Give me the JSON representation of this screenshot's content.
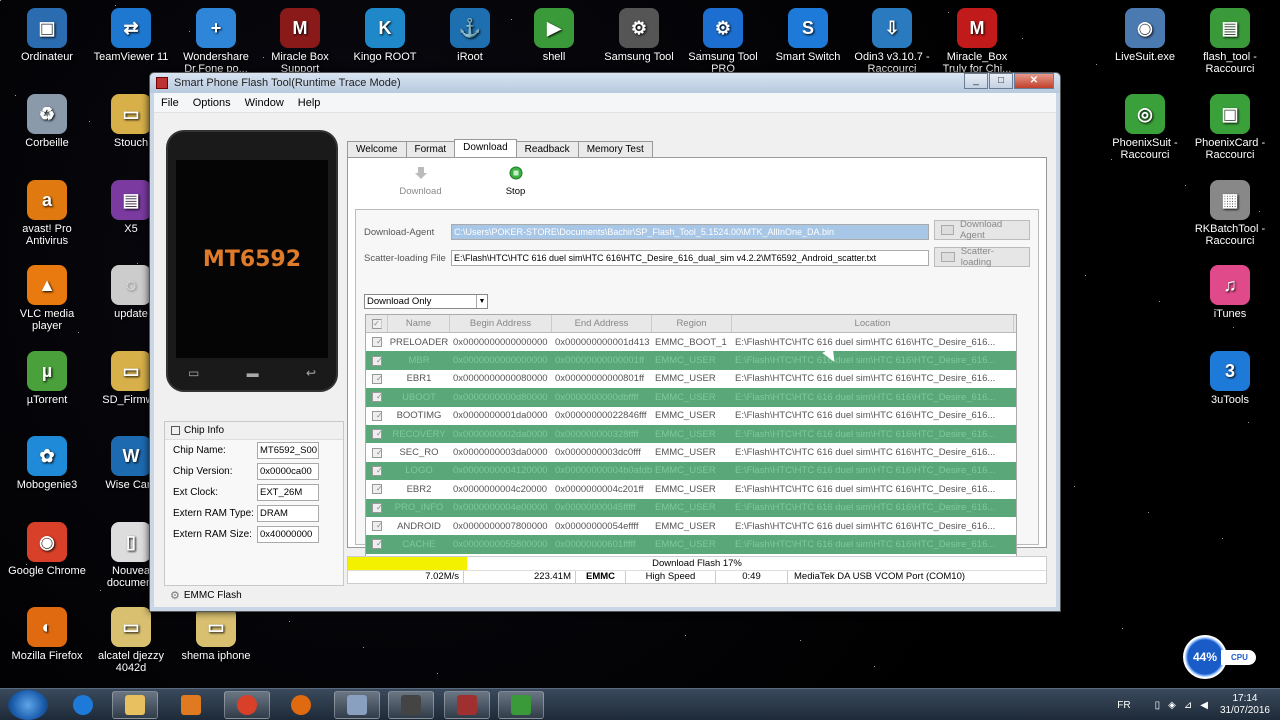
{
  "desktop_icons": [
    {
      "name": "ordinateur",
      "label": "Ordinateur",
      "color": "#2b6cb0",
      "glyph": "▣"
    },
    {
      "name": "teamviewer",
      "label": "TeamViewer 11",
      "color": "#1e78d0",
      "glyph": "⇄"
    },
    {
      "name": "wondershare",
      "label": "Wondershare Dr.Fone po...",
      "color": "#2f85d8",
      "glyph": "+"
    },
    {
      "name": "miracle-box",
      "label": "Miracle Box Support",
      "color": "#8a1a1a",
      "glyph": "M"
    },
    {
      "name": "kingo-root",
      "label": "Kingo ROOT",
      "color": "#1e88c8",
      "glyph": "K"
    },
    {
      "name": "iroot",
      "label": "iRoot",
      "color": "#1e6fb0",
      "glyph": "⚓"
    },
    {
      "name": "shell",
      "label": "shell",
      "color": "#3a9a3a",
      "glyph": "▶"
    },
    {
      "name": "samsung-tool",
      "label": "Samsung Tool",
      "color": "#555",
      "glyph": "⚙"
    },
    {
      "name": "samsung-tool-pro",
      "label": "Samsung Tool PRO",
      "color": "#1c6fd0",
      "glyph": "⚙"
    },
    {
      "name": "smart-switch",
      "label": "Smart Switch",
      "color": "#1e7ad8",
      "glyph": "S"
    },
    {
      "name": "odin",
      "label": "Odin3 v3.10.7 - Raccourci",
      "color": "#2a7ac0",
      "glyph": "⇩"
    },
    {
      "name": "miracle-box-truly",
      "label": "Miracle_Box Truly for Chi...",
      "color": "#c01a1a",
      "glyph": "M"
    },
    {
      "name": "livesuit",
      "label": "LiveSuit.exe",
      "color": "#4a7ab0",
      "glyph": "◉"
    },
    {
      "name": "flash-tool",
      "label": "flash_tool - Raccourci",
      "color": "#3a9a3a",
      "glyph": "▤"
    },
    {
      "name": "corbeille",
      "label": "Corbeille",
      "color": "#8a9aaa",
      "glyph": "♻"
    },
    {
      "name": "stouch",
      "label": "Stouch",
      "color": "#d8b04a",
      "glyph": "▭"
    },
    {
      "name": "phoenixsuit",
      "label": "PhoenixSuit - Raccourci",
      "color": "#3aa03a",
      "glyph": "◎"
    },
    {
      "name": "phoenixcard",
      "label": "PhoenixCard - Raccourci",
      "color": "#3aa03a",
      "glyph": "▣"
    },
    {
      "name": "avast",
      "label": "avast! Pro Antivirus",
      "color": "#e07a10",
      "glyph": "a"
    },
    {
      "name": "x5",
      "label": "X5",
      "color": "#7a3aa0",
      "glyph": "▤"
    },
    {
      "name": "rkbatchtool",
      "label": "RKBatchTool - Raccourci",
      "color": "#888",
      "glyph": "▦"
    },
    {
      "name": "vlc",
      "label": "VLC media player",
      "color": "#e87a10",
      "glyph": "▲"
    },
    {
      "name": "update",
      "label": "update",
      "color": "#ccc",
      "glyph": "◌"
    },
    {
      "name": "itunes",
      "label": "iTunes",
      "color": "#e04a8a",
      "glyph": "♫"
    },
    {
      "name": "utorrent",
      "label": "µTorrent",
      "color": "#4aa03a",
      "glyph": "µ"
    },
    {
      "name": "sd-firmware",
      "label": "SD_Firmwa",
      "color": "#d8b04a",
      "glyph": "▭"
    },
    {
      "name": "3utools",
      "label": "3uTools",
      "color": "#1e7ad8",
      "glyph": "3"
    },
    {
      "name": "mobogenie",
      "label": "Mobogenie3",
      "color": "#1e8ad8",
      "glyph": "✿"
    },
    {
      "name": "wise-care",
      "label": "Wise Care",
      "color": "#1e6ab0",
      "glyph": "W"
    },
    {
      "name": "chrome",
      "label": "Google Chrome",
      "color": "#d8402a",
      "glyph": "◉"
    },
    {
      "name": "nouveau-document",
      "label": "Nouvea document",
      "color": "#ddd",
      "glyph": "▯"
    },
    {
      "name": "firefox",
      "label": "Mozilla Firefox",
      "color": "#e06a10",
      "glyph": "◐"
    },
    {
      "name": "alcatel",
      "label": "alcatel djezzy 4042d",
      "color": "#d8c070",
      "glyph": "▭"
    },
    {
      "name": "shema",
      "label": "shema iphone",
      "color": "#d8c070",
      "glyph": "▭"
    }
  ],
  "window": {
    "title": "Smart Phone Flash Tool(Runtime Trace Mode)",
    "menu": [
      "File",
      "Options",
      "Window",
      "Help"
    ],
    "phone_chip_text": "MT6592",
    "tabs": [
      "Welcome",
      "Format",
      "Download",
      "Readback",
      "Memory Test"
    ],
    "toolbar": {
      "download": "Download",
      "stop": "Stop"
    },
    "download_agent_label": "Download-Agent",
    "download_agent_value": "C:\\Users\\POKER-STORE\\Documents\\Bachir\\SP_Flash_Tool_5.1524.00\\MTK_AllInOne_DA.bin",
    "download_agent_button": "Download Agent",
    "scatter_label": "Scatter-loading File",
    "scatter_value": "E:\\Flash\\HTC\\HTC 616 duel sim\\HTC 616\\HTC_Desire_616_dual_sim v4.2.2\\MT6592_Android_scatter.txt",
    "scatter_button": "Scatter-loading",
    "mode_select": "Download Only",
    "table_headers": [
      "Name",
      "Begin Address",
      "End Address",
      "Region",
      "Location"
    ],
    "table_rows": [
      {
        "name": "PRELOADER",
        "begin": "0x0000000000000000",
        "end": "0x000000000001d413",
        "region": "EMMC_BOOT_1",
        "location": "E:\\Flash\\HTC\\HTC 616 duel sim\\HTC 616\\HTC_Desire_616...",
        "hl": false
      },
      {
        "name": "MBR",
        "begin": "0x0000000000000000",
        "end": "0x00000000000001ff",
        "region": "EMMC_USER",
        "location": "E:\\Flash\\HTC\\HTC 616 duel sim\\HTC 616\\HTC_Desire_616...",
        "hl": true
      },
      {
        "name": "EBR1",
        "begin": "0x0000000000080000",
        "end": "0x00000000000801ff",
        "region": "EMMC_USER",
        "location": "E:\\Flash\\HTC\\HTC 616 duel sim\\HTC 616\\HTC_Desire_616...",
        "hl": false
      },
      {
        "name": "UBOOT",
        "begin": "0x0000000000d80000",
        "end": "0x0000000000dbffff",
        "region": "EMMC_USER",
        "location": "E:\\Flash\\HTC\\HTC 616 duel sim\\HTC 616\\HTC_Desire_616...",
        "hl": true
      },
      {
        "name": "BOOTIMG",
        "begin": "0x0000000001da0000",
        "end": "0x00000000022846fff",
        "region": "EMMC_USER",
        "location": "E:\\Flash\\HTC\\HTC 616 duel sim\\HTC 616\\HTC_Desire_616...",
        "hl": false
      },
      {
        "name": "RECOVERY",
        "begin": "0x0000000002da0000",
        "end": "0x000000000328ffff",
        "region": "EMMC_USER",
        "location": "E:\\Flash\\HTC\\HTC 616 duel sim\\HTC 616\\HTC_Desire_616...",
        "hl": true
      },
      {
        "name": "SEC_RO",
        "begin": "0x0000000003da0000",
        "end": "0x0000000003dc0fff",
        "region": "EMMC_USER",
        "location": "E:\\Flash\\HTC\\HTC 616 duel sim\\HTC 616\\HTC_Desire_616...",
        "hl": false
      },
      {
        "name": "LOGO",
        "begin": "0x0000000004120000",
        "end": "0x00000000004b0afdb",
        "region": "EMMC_USER",
        "location": "E:\\Flash\\HTC\\HTC 616 duel sim\\HTC 616\\HTC_Desire_616...",
        "hl": true
      },
      {
        "name": "EBR2",
        "begin": "0x0000000004c20000",
        "end": "0x0000000004c201ff",
        "region": "EMMC_USER",
        "location": "E:\\Flash\\HTC\\HTC 616 duel sim\\HTC 616\\HTC_Desire_616...",
        "hl": false
      },
      {
        "name": "PRO_INFO",
        "begin": "0x0000000004e00000",
        "end": "0x00000000045fffff",
        "region": "EMMC_USER",
        "location": "E:\\Flash\\HTC\\HTC 616 duel sim\\HTC 616\\HTC_Desire_616...",
        "hl": true
      },
      {
        "name": "ANDROID",
        "begin": "0x0000000007800000",
        "end": "0x00000000054effff",
        "region": "EMMC_USER",
        "location": "E:\\Flash\\HTC\\HTC 616 duel sim\\HTC 616\\HTC_Desire_616...",
        "hl": false
      },
      {
        "name": "CACHE",
        "begin": "0x0000000055800000",
        "end": "0x00000000601fffff",
        "region": "EMMC_USER",
        "location": "E:\\Flash\\HTC\\HTC 616 duel sim\\HTC 616\\HTC_Desire_616...",
        "hl": true
      },
      {
        "name": "USRDATA",
        "begin": "0x0000000062000000",
        "end": "0x0000000063001fff",
        "region": "EMMC_USER",
        "location": "E:\\Flash\\HTC\\HTC 616 duel sim\\HTC 616\\HTC_Desire_616...",
        "hl": false
      }
    ],
    "chip_info": {
      "title": "Chip Info",
      "rows": [
        {
          "label": "Chip Name:",
          "value": "MT6592_S00"
        },
        {
          "label": "Chip Version:",
          "value": "0x0000ca00"
        },
        {
          "label": "Ext Clock:",
          "value": "EXT_26M"
        },
        {
          "label": "Extern RAM Type:",
          "value": "DRAM"
        },
        {
          "label": "Extern RAM Size:",
          "value": "0x40000000"
        }
      ]
    },
    "emmc_label": "EMMC Flash",
    "progress_text": "Download Flash 17%",
    "progress": 0.17,
    "status": {
      "speed": "7.02M/s",
      "size": "223.41M",
      "storage": "EMMC",
      "usb": "High Speed",
      "time": "0:49",
      "port": "MediaTek DA USB VCOM Port (COM10)"
    }
  },
  "taskbar": {
    "lang": "FR",
    "time": "17:14",
    "date": "31/07/2016"
  },
  "cpu_widget": {
    "percent": "44%",
    "label": "CPU"
  }
}
